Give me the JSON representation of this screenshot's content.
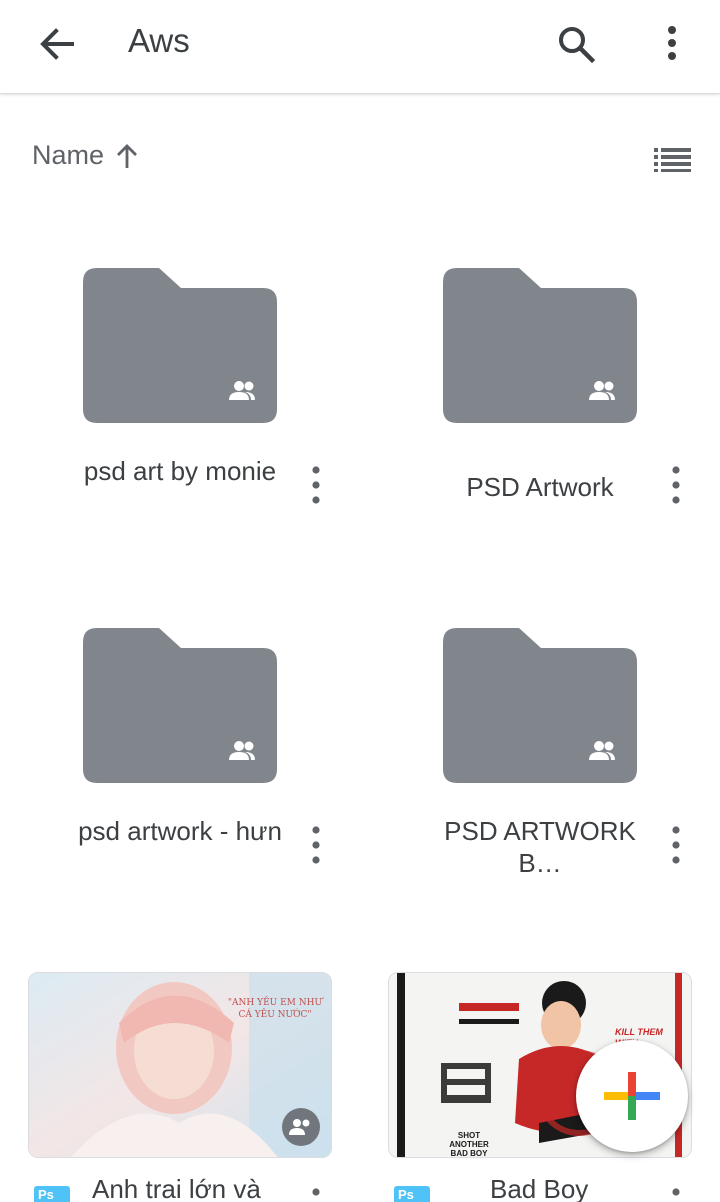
{
  "app_bar": {
    "title": "Aws",
    "back_icon": "arrow-back-icon",
    "search_icon": "search-icon",
    "more_icon": "more-vert-icon"
  },
  "sort": {
    "label": "Name",
    "direction_icon": "arrow-up-icon",
    "view_icon": "list-view-icon"
  },
  "items": [
    {
      "name": "psd art by monie",
      "type": "shared-folder"
    },
    {
      "name": "PSD Artwork",
      "type": "shared-folder"
    },
    {
      "name": "psd artwork - hưn",
      "type": "shared-folder"
    },
    {
      "name": "PSD ARTWORK B…",
      "type": "shared-folder"
    },
    {
      "name": "Anh trai lớn và",
      "type": "psd-file",
      "thumb_text": "\"ANH YÊU EM NHƯ CÁ YÊU NƯỚC\""
    },
    {
      "name": "Bad Boy",
      "type": "psd-file",
      "thumb_text_top": "KILL THEM WITH",
      "thumb_text_bottom": "SHOT ANOTHER BAD BOY"
    }
  ],
  "fab": {
    "icon": "plus-icon"
  },
  "colors": {
    "folder": "#80868b",
    "text": "#3c4043",
    "secondary": "#5f6368",
    "google_blue": "#4285f4",
    "google_red": "#ea4335",
    "google_yellow": "#fbbc04",
    "google_green": "#34a853",
    "file_badge": "#4fc3f7"
  }
}
